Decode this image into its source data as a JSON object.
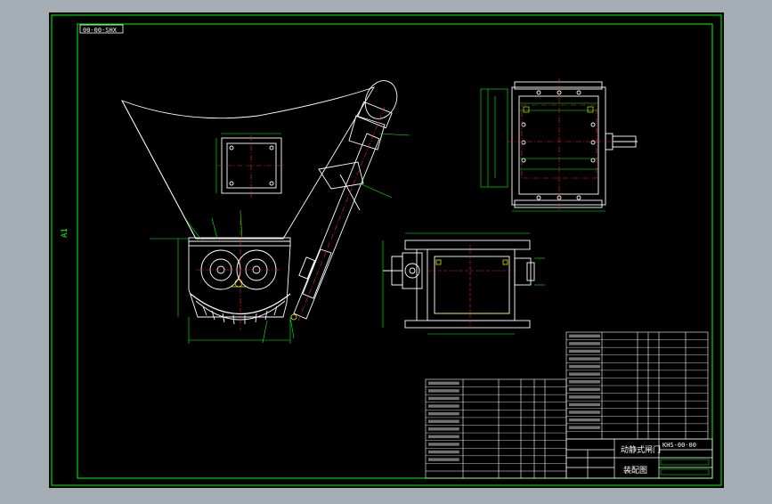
{
  "drawing": {
    "sheet_size": "A1",
    "drawing_code_box": "00-00-SHX",
    "title_name": "动静式闸门",
    "title_sub": "装配图",
    "title_number": "KHS-00-00"
  },
  "colors": {
    "outer_bg": "#a5adb5",
    "sheet": "#000000",
    "frame": "#00ff00",
    "lines": "#ffffff",
    "center": "#ff2020",
    "dims": "#00ff00",
    "hidden": "#ffff00"
  }
}
